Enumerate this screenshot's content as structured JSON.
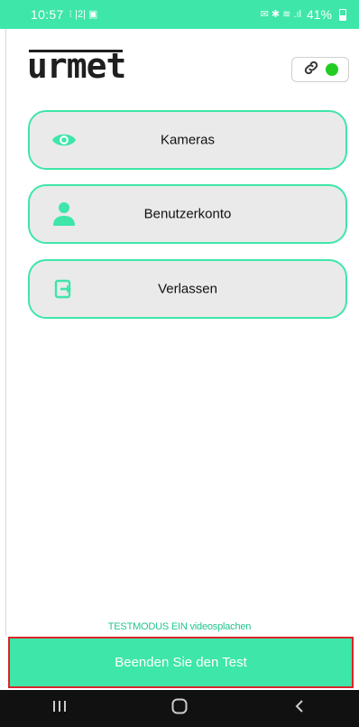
{
  "status_bar": {
    "time": "10:57",
    "battery": "41%"
  },
  "header": {
    "logo_text": "urmet",
    "connection_status_color": "#22cc22"
  },
  "menu": {
    "items": [
      {
        "label": "Kameras",
        "icon": "eye-icon"
      },
      {
        "label": "Benutzerkonto",
        "icon": "person-icon"
      },
      {
        "label": "Verlassen",
        "icon": "exit-icon"
      }
    ]
  },
  "footer": {
    "test_mode_text": "TESTMODUS EIN videosplachen",
    "end_test_label": "Beenden Sie den Test"
  },
  "colors": {
    "accent": "#3ee6a9",
    "highlight_border": "#d9262a"
  }
}
